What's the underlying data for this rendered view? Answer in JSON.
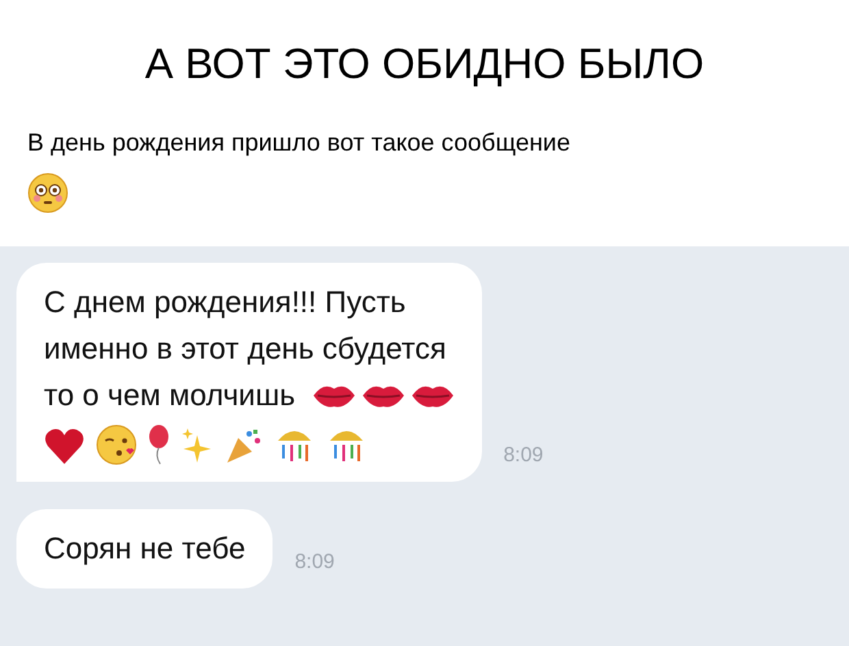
{
  "caption": {
    "title": "А ВОТ ЭТО ОБИДНО БЫЛО",
    "subtitle": "В день рождения пришло вот такое сообщение"
  },
  "messages": [
    {
      "lines": [
        "С днем рождения!!! Пусть",
        "именно в этот день сбудется",
        "то о чем молчишь"
      ],
      "time": "8:09",
      "kind": "emoji"
    },
    {
      "lines": [
        "Сорян не тебе"
      ],
      "time": "8:09",
      "kind": "plain"
    }
  ]
}
